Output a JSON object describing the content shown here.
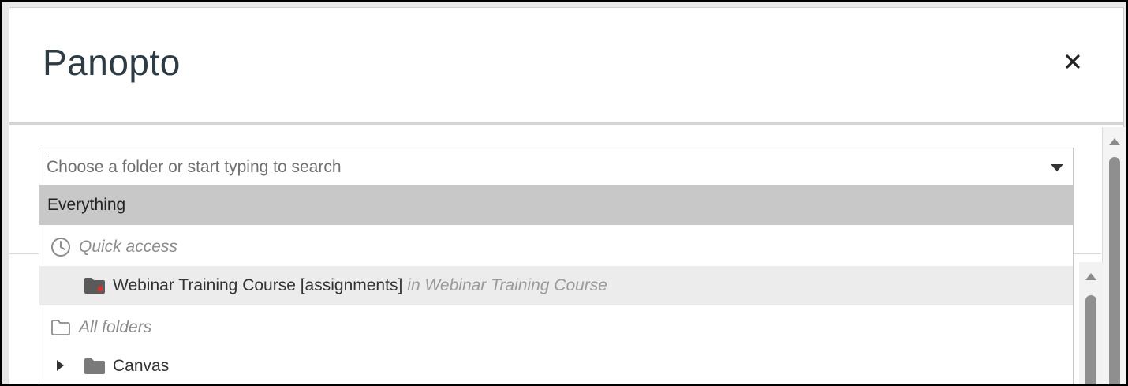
{
  "dialog": {
    "title": "Panopto",
    "close_icon": "close-icon"
  },
  "folder_select": {
    "placeholder": "Choose a folder or start typing to search",
    "value": "",
    "arrow_icon": "caret-down-icon"
  },
  "dropdown": {
    "everything_label": "Everything",
    "quick_access": {
      "label": "Quick access",
      "icon": "clock-icon",
      "items": [
        {
          "name": "Webinar Training Course [assignments]",
          "context": "in Webinar Training Course",
          "icon": "assignment-folder-icon"
        }
      ]
    },
    "all_folders": {
      "label": "All folders",
      "icon": "folder-outline-icon",
      "items": [
        {
          "name": "Canvas",
          "icon": "folder-icon",
          "expandable": true
        }
      ]
    }
  },
  "colors": {
    "selected_option_bg": "#c8c8c8",
    "hover_option_bg": "#ececec",
    "title_text": "#2d3b45",
    "assignment_badge": "#d9302c"
  }
}
